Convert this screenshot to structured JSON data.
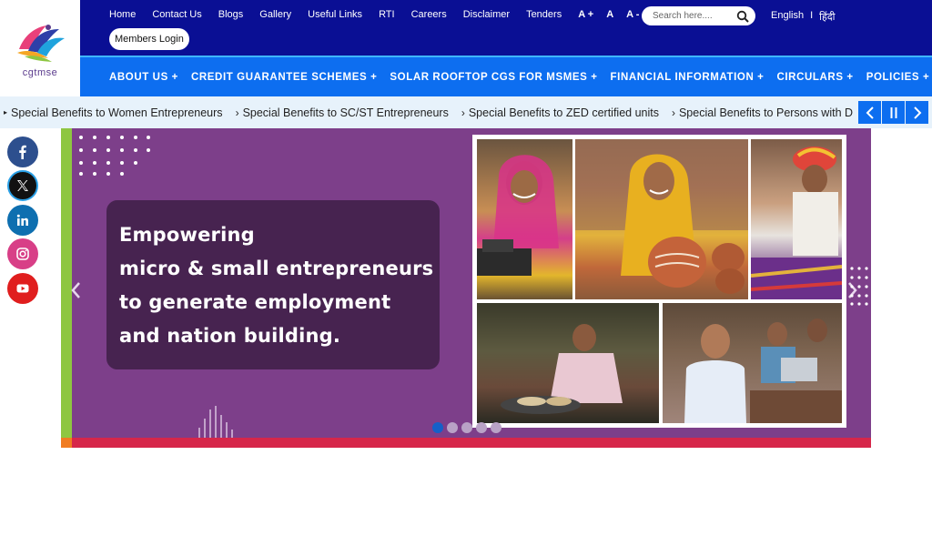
{
  "logo": {
    "text": "cgtmse"
  },
  "topbar": {
    "links": [
      "Home",
      "Contact Us",
      "Blogs",
      "Gallery",
      "Useful Links",
      "RTI",
      "Careers",
      "Disclaimer",
      "Tenders"
    ],
    "font_sizes": [
      "A +",
      "A",
      "A -"
    ],
    "search_placeholder": "Search here....",
    "lang_english": "English",
    "lang_sep": "I",
    "lang_hindi": "हिंदी",
    "members_login": "Members Login"
  },
  "menu": {
    "items": [
      "ABOUT US +",
      "CREDIT GUARANTEE SCHEMES +",
      "SOLAR ROOFTOP CGS FOR MSMES +",
      "FINANCIAL INFORMATION +",
      "CIRCULARS +",
      "POLICIES +"
    ]
  },
  "ticker": {
    "items": [
      "Special Benefits to Women Entrepreneurs",
      "Special Benefits to SC/ST Entrepreneurs",
      "Special Benefits to ZED certified units",
      "Special Benefits to Persons with D"
    ]
  },
  "banner": {
    "lines": [
      "Empowering",
      "micro & small entrepreneurs",
      "to generate employment",
      "and nation building."
    ],
    "slide_count": 5,
    "active_slide": 1
  },
  "colors": {
    "navy": "#0a0f94",
    "menu_blue": "#0d6ef0",
    "banner_purple": "#7d3f8a",
    "accent_green": "#8ec641",
    "accent_red": "#d6274a"
  },
  "social": [
    "facebook-icon",
    "x-icon",
    "linkedin-icon",
    "instagram-icon",
    "youtube-icon"
  ]
}
